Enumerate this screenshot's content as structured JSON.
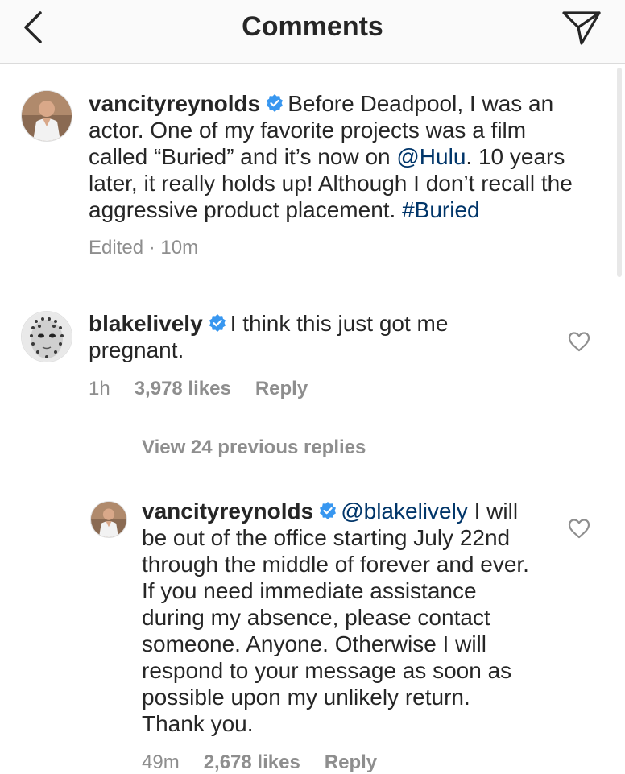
{
  "header": {
    "title": "Comments",
    "back_icon": "chevron-left-icon",
    "send_icon": "paper-plane-icon"
  },
  "caption": {
    "username": "vancityreynolds",
    "verified": true,
    "text_before_mention": "Before Deadpool, I was an actor. One of my favorite projects was a film called “Buried” and it’s now on ",
    "mention": "@Hulu",
    "text_after_mention": ". 10 years later, it really holds up! Although I don’t recall the aggressive product placement. ",
    "hashtag": "#Buried",
    "meta": "Edited · 10m"
  },
  "comments": [
    {
      "username": "blakelively",
      "verified": true,
      "text": "I think this just got me pregnant.",
      "time": "1h",
      "likes": "3,978 likes",
      "reply_label": "Reply"
    }
  ],
  "view_replies_label": "View 24 previous replies",
  "reply": {
    "username": "vancityreynolds",
    "verified": true,
    "mention": "@blakelively",
    "text": " I will be out of the office starting July 22nd through the middle of forever and ever. If you need immediate assistance during my absence, please contact someone. Anyone. Otherwise I will respond to your message as soon as possible upon my unlikely return. Thank you.",
    "time": "49m",
    "likes": "2,678 likes",
    "reply_label": "Reply"
  },
  "colors": {
    "link": "#003569",
    "verified_badge": "#3897f0",
    "secondary_text": "#8e8e8e",
    "divider": "#dbdbdb"
  }
}
